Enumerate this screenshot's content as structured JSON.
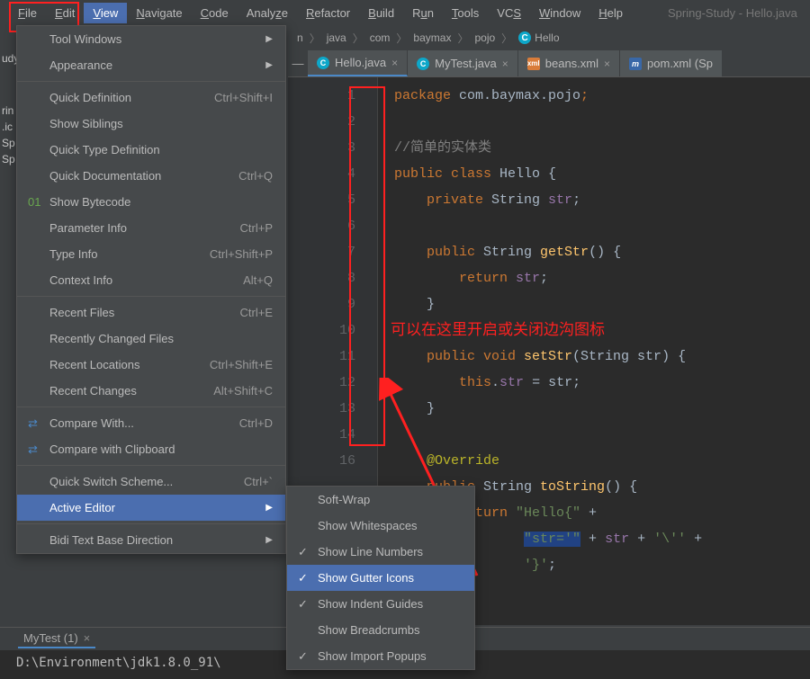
{
  "window_title": "Spring-Study - Hello.java",
  "menubar": [
    "File",
    "Edit",
    "View",
    "Navigate",
    "Code",
    "Analyze",
    "Refactor",
    "Build",
    "Run",
    "Tools",
    "VCS",
    "Window",
    "Help"
  ],
  "menubar_selected": "View",
  "breadcrumb": {
    "start": "n",
    "parts": [
      "java",
      "com",
      "baymax",
      "pojo"
    ],
    "final_icon": "C",
    "final": "Hello"
  },
  "tabs": [
    {
      "icon": "C",
      "icon_kind": "class",
      "label": "Hello.java",
      "active": true
    },
    {
      "icon": "C",
      "icon_kind": "class",
      "label": "MyTest.java",
      "active": false
    },
    {
      "icon": "</>",
      "icon_kind": "xml",
      "label": "beans.xml",
      "active": false
    },
    {
      "icon": "m",
      "icon_kind": "maven",
      "label": "pom.xml (Sp",
      "active": false
    }
  ],
  "sidebar_frags": [
    "udy",
    "rin",
    ".ic",
    "Sp",
    "Sp"
  ],
  "view_menu": [
    {
      "label": "Tool Windows",
      "type": "submenu"
    },
    {
      "label": "Appearance",
      "type": "submenu"
    },
    {
      "type": "sep"
    },
    {
      "label": "Quick Definition",
      "shortcut": "Ctrl+Shift+I"
    },
    {
      "label": "Show Siblings"
    },
    {
      "label": "Quick Type Definition"
    },
    {
      "label": "Quick Documentation",
      "shortcut": "Ctrl+Q"
    },
    {
      "label": "Show Bytecode",
      "icon": "bytecode"
    },
    {
      "label": "Parameter Info",
      "shortcut": "Ctrl+P"
    },
    {
      "label": "Type Info",
      "shortcut": "Ctrl+Shift+P"
    },
    {
      "label": "Context Info",
      "shortcut": "Alt+Q"
    },
    {
      "type": "sep"
    },
    {
      "label": "Recent Files",
      "shortcut": "Ctrl+E"
    },
    {
      "label": "Recently Changed Files"
    },
    {
      "label": "Recent Locations",
      "shortcut": "Ctrl+Shift+E"
    },
    {
      "label": "Recent Changes",
      "shortcut": "Alt+Shift+C"
    },
    {
      "type": "sep"
    },
    {
      "label": "Compare With...",
      "shortcut": "Ctrl+D",
      "icon": "compare"
    },
    {
      "label": "Compare with Clipboard",
      "icon": "compare"
    },
    {
      "type": "sep"
    },
    {
      "label": "Quick Switch Scheme...",
      "shortcut": "Ctrl+`"
    },
    {
      "label": "Active Editor",
      "type": "submenu",
      "highlight": true
    },
    {
      "type": "sep"
    },
    {
      "label": "Bidi Text Base Direction",
      "type": "submenu"
    }
  ],
  "active_editor_submenu": [
    {
      "label": "Soft-Wrap"
    },
    {
      "label": "Show Whitespaces"
    },
    {
      "label": "Show Line Numbers",
      "check": true
    },
    {
      "label": "Show Gutter Icons",
      "check": true,
      "highlight": true
    },
    {
      "label": "Show Indent Guides",
      "check": true
    },
    {
      "label": "Show Breadcrumbs"
    },
    {
      "label": "Show Import Popups",
      "check": true
    }
  ],
  "code": {
    "lines": [
      1,
      2,
      3,
      4,
      5,
      6,
      7,
      8,
      9,
      10,
      11,
      12,
      13,
      14,
      "",
      16
    ],
    "l1": "package com.baymax.pojo;",
    "l3": "//简单的实体类",
    "l4_a": "public class ",
    "l4_b": "Hello ",
    "l4_c": "{",
    "l5_a": "    private ",
    "l5_b": "String ",
    "l5_c": "str",
    "l5_d": ";",
    "l7_a": "    public ",
    "l7_b": "String ",
    "l7_c": "getStr",
    "l7_d": "() {",
    "l8_a": "        return ",
    "l8_b": "str",
    "l8_c": ";",
    "l9": "    }",
    "l11_a": "    public void ",
    "l11_b": "setStr",
    "l11_c": "(String str) {",
    "l12_a": "        this",
    "l12_b": ".",
    "l12_c": "str",
    "l12_d": " = str;",
    "l13": "    }",
    "l15": "    @Override",
    "l16_a": "    public ",
    "l16_b": "String ",
    "l16_c": "toString",
    "l16_d": "() {",
    "l17_a": "        return ",
    "l17_b": "\"Hello{\"",
    "l17_c": " +",
    "l18_a": "                ",
    "l18_b": "\"str='\"",
    "l18_c": " + ",
    "l18_d": "str",
    "l18_e": " + ",
    "l18_f": "'\\''",
    "l18_g": " +",
    "l19_a": "                ",
    "l19_b": "'}'",
    "l19_c": ";"
  },
  "annotation_text": "可以在这里开启或关闭边沟图标",
  "bottom_tool": {
    "tab": "MyTest (1)"
  },
  "terminal": "D:\\Environment\\jdk1.8.0_91\\"
}
